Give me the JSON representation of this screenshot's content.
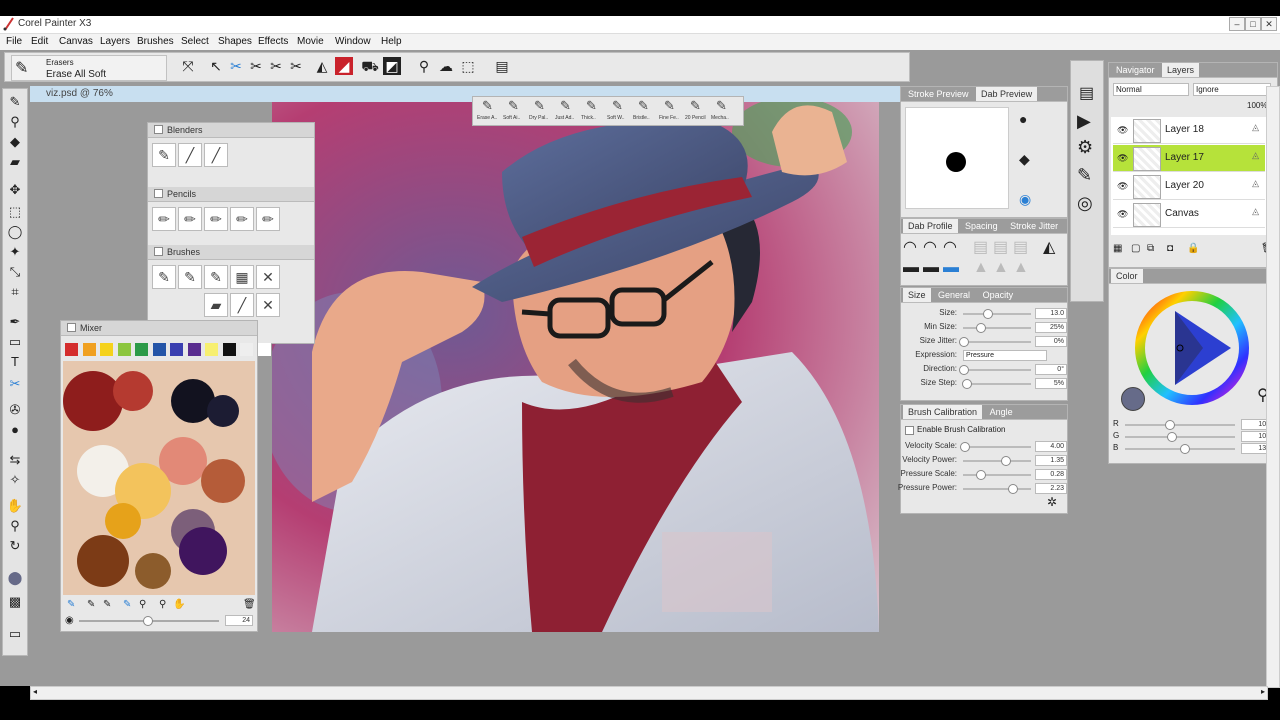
{
  "app": {
    "title": "Corel Painter X3"
  },
  "menu": [
    "File",
    "Edit",
    "Canvas",
    "Layers",
    "Brushes",
    "Select",
    "Shapes",
    "Effects",
    "Movie",
    "Window",
    "Help"
  ],
  "toolprop": {
    "category": "Erasers",
    "variant": "Erase All Soft"
  },
  "document": {
    "tab": "viz.psd @ 76%"
  },
  "brush_strip": [
    "Erase A..",
    "Soft Ai..",
    "Dry Pal..",
    "Just Ad..",
    "Thick..",
    "Soft W..",
    "Bristle..",
    "Fine Fe..",
    "20 Pencil",
    "Mecha.."
  ],
  "panels": {
    "blenders": "Blenders",
    "pencils": "Pencils",
    "brushes": "Brushes",
    "mixer": {
      "title": "Mixer",
      "colors": [
        "#d42d2d",
        "#f0a020",
        "#f5d21b",
        "#8cc63e",
        "#2c9a48",
        "#2455a8",
        "#3a3fb0",
        "#5a2c8f",
        "#f7ef70",
        "#111111",
        "#eeeeee",
        "#ffffff"
      ],
      "value": "24"
    },
    "stroke_tabs": [
      "Stroke Preview",
      "Dab Preview"
    ],
    "dab_tabs": [
      "Dab Profile",
      "Spacing",
      "Stroke Jitter"
    ],
    "size_tabs": [
      "Size",
      "General",
      "Opacity"
    ],
    "size_controls": [
      {
        "label": "Size:",
        "value": "13.0",
        "level": 0.35
      },
      {
        "label": "Min Size:",
        "value": "25%",
        "level": 0.25
      },
      {
        "label": "Size Jitter:",
        "value": "0%",
        "level": 0.0
      },
      {
        "label": "Expression:",
        "value": "Pressure",
        "level": null
      },
      {
        "label": "Direction:",
        "value": "0°",
        "level": 0.0
      },
      {
        "label": "Size Step:",
        "value": "5%",
        "level": 0.05
      }
    ],
    "calibration_tabs": [
      "Brush Calibration",
      "Angle"
    ],
    "enable_calibration": "Enable Brush Calibration",
    "calibration_controls": [
      {
        "label": "Velocity Scale:",
        "value": "4.00",
        "level": 0.02
      },
      {
        "label": "Velocity Power:",
        "value": "1.35",
        "level": 0.62
      },
      {
        "label": "Pressure Scale:",
        "value": "0.28",
        "level": 0.25
      },
      {
        "label": "Pressure Power:",
        "value": "2.23",
        "level": 0.72
      }
    ],
    "layers_tabs": [
      "Navigator",
      "Layers"
    ],
    "blend_mode": "Normal",
    "composite": "Ignore",
    "opacity": "100%",
    "layers": [
      {
        "name": "Layer 18",
        "selected": false
      },
      {
        "name": "Layer 17",
        "selected": true
      },
      {
        "name": "Layer 20",
        "selected": false
      },
      {
        "name": "Canvas",
        "selected": false
      }
    ],
    "color": {
      "title": "Color",
      "rgb": [
        {
          "label": "R",
          "value": "102",
          "level": 0.4
        },
        {
          "label": "G",
          "value": "107",
          "level": 0.42
        },
        {
          "label": "B",
          "value": "137",
          "level": 0.54
        }
      ],
      "current": "#666b89"
    }
  },
  "colors": {
    "accent": "#b6e23a",
    "tab_blue": "#c8dff0",
    "workspace": "#9a9a9a"
  }
}
